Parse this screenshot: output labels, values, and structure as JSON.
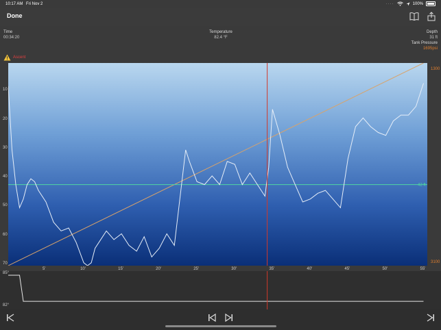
{
  "status": {
    "time": "10:17 AM",
    "date": "Fri Nov 2",
    "battery": "100%"
  },
  "nav": {
    "done_label": "Done",
    "icons": [
      "book-icon",
      "export-icon"
    ]
  },
  "readouts": {
    "time_label": "Time",
    "time_value": "00:34:20",
    "temp_label": "Temperature",
    "temp_value": "82.4 °F",
    "depth_label": "Depth",
    "depth_value": "31 ft",
    "tank_label": "Tank Pressure",
    "tank_value": "1695psi"
  },
  "warning": {
    "icon": "warning-icon",
    "text": "Ascent"
  },
  "colors": {
    "depth_line": "#e6eef8",
    "pressure_line": "#d9a36a",
    "ref_line": "#4fd6a0",
    "cursor": "#d0392b",
    "ascent": "#c0392b"
  },
  "chart_data": {
    "type": "line",
    "y_ticks": [
      "10",
      "20",
      "30",
      "40",
      "50",
      "60",
      "70"
    ],
    "x_ticks": [
      "5'",
      "10'",
      "15'",
      "20'",
      "25'",
      "30'",
      "35'",
      "40'",
      "45'",
      "50'",
      "55'"
    ],
    "xlim": [
      0,
      55.5
    ],
    "ylim": [
      0,
      70
    ],
    "pressure_axis": {
      "top_label": "1300",
      "bottom_label": "3100",
      "min": 1300,
      "max": 3100
    },
    "reference_depth": {
      "value": 42,
      "label": "42 ft"
    },
    "cursor_time_min": 34.3,
    "depth_series": {
      "x": [
        0,
        0.5,
        1,
        1.5,
        2,
        2.5,
        3,
        3.5,
        4,
        5,
        6,
        7,
        8,
        9,
        10,
        10.5,
        11,
        11.5,
        12,
        13,
        14,
        15,
        16,
        17,
        18,
        19,
        20,
        21,
        22,
        22.5,
        23,
        23.5,
        24,
        25,
        26,
        27,
        28,
        29,
        30,
        31,
        32,
        33,
        34,
        34.5,
        35,
        36,
        37,
        38,
        39,
        40,
        41,
        42,
        43,
        44,
        45,
        46,
        47,
        48,
        49,
        50,
        51,
        52,
        53,
        54,
        55
      ],
      "y": [
        8,
        30,
        42,
        50,
        47,
        42,
        40,
        41,
        44,
        48,
        55,
        58,
        57,
        62,
        69,
        70,
        69,
        64,
        62,
        58,
        61,
        59,
        63,
        65,
        60,
        67,
        64,
        59,
        63,
        52,
        41,
        30,
        34,
        41,
        42,
        39,
        42,
        34,
        35,
        42,
        38,
        42,
        46,
        36,
        16,
        25,
        36,
        42,
        48,
        47,
        45,
        44,
        47,
        50,
        33,
        22,
        19,
        22,
        24,
        25,
        20,
        18,
        18,
        15,
        7
      ]
    },
    "pressure_series": {
      "x": [
        0,
        55
      ],
      "y": [
        3100,
        1300
      ]
    }
  },
  "temp_chart": {
    "top_label": "85°",
    "bottom_label": "82°",
    "x": [
      0,
      1.5,
      2,
      55
    ],
    "y": [
      85,
      85,
      82.4,
      82.4
    ],
    "ylim": [
      82,
      85
    ]
  },
  "controls": [
    "skip-start-icon",
    "step-back-icon",
    "step-forward-icon",
    "skip-end-icon"
  ]
}
